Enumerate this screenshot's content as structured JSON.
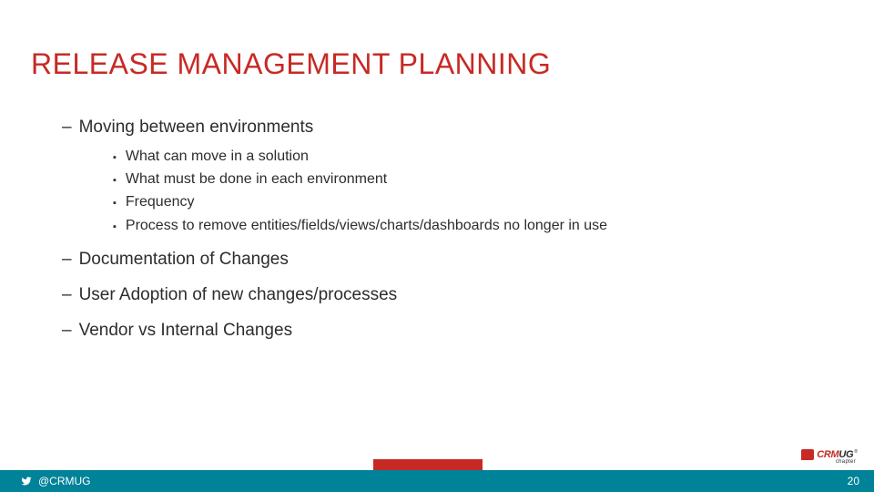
{
  "title": "RELEASE MANAGEMENT PLANNING",
  "bullets": {
    "l1_0": "Moving between environments",
    "l1_0_sub_0": "What can move in a solution",
    "l1_0_sub_1": "What must be done in each environment",
    "l1_0_sub_2": "Frequency",
    "l1_0_sub_3": "Process to remove entities/fields/views/charts/dashboards no longer in use",
    "l1_1": "Documentation of Changes",
    "l1_2": "User Adoption of new changes/processes",
    "l1_3": "Vendor vs Internal Changes"
  },
  "footer": {
    "handle": "@CRMUG",
    "page": "20"
  },
  "logo": {
    "crm": "CRM",
    "ug": "UG",
    "r": "®",
    "chapter": "chapter"
  }
}
